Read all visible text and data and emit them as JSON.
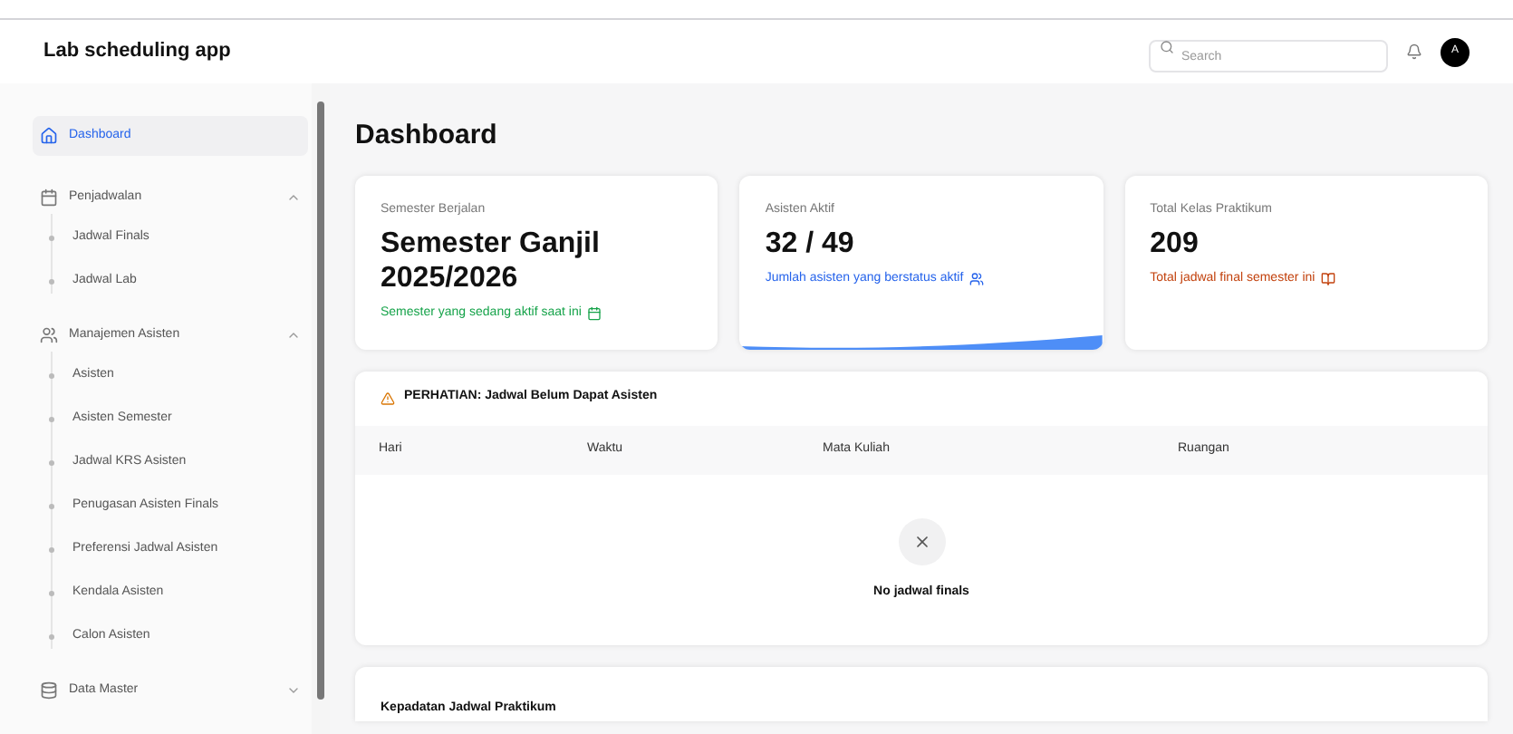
{
  "app": {
    "title": "Lab scheduling app",
    "search": {
      "placeholder": "Search"
    },
    "avatar": "A"
  },
  "sidebar": {
    "items": [
      {
        "kind": "link",
        "label": "Dashboard",
        "selected": true
      },
      {
        "kind": "group",
        "label": "Penjadwalan",
        "expanded": true,
        "children": [
          {
            "label": "Jadwal Finals",
            "selected": false
          },
          {
            "label": "Jadwal Lab",
            "selected": false
          }
        ]
      },
      {
        "kind": "group",
        "label": "Manajemen Asisten",
        "expanded": true,
        "children": [
          {
            "label": "Asisten",
            "selected": false
          },
          {
            "label": "Asisten Semester",
            "selected": false
          },
          {
            "label": "Jadwal KRS Asisten",
            "selected": false
          },
          {
            "label": "Penugasan Asisten Finals",
            "selected": false
          },
          {
            "label": "Preferensi Jadwal Asisten",
            "selected": false
          },
          {
            "label": "Kendala Asisten",
            "selected": false
          },
          {
            "label": "Calon Asisten",
            "selected": false
          }
        ]
      },
      {
        "kind": "group",
        "label": "Data Master",
        "expanded": false
      }
    ]
  },
  "page": {
    "title": "Dashboard",
    "stats": [
      {
        "label": "Semester Berjalan",
        "value": "Semester Ganjil 2025/2026",
        "note": "Semester yang sedang aktif saat ini",
        "color": "#16a34a"
      },
      {
        "label": "Asisten Aktif",
        "value": "32 / 49",
        "note": "Jumlah asisten yang berstatus aktif",
        "color": "#2563eb"
      },
      {
        "label": "Total Kelas Praktikum",
        "value": "209",
        "note": "Total jadwal final semester ini",
        "color": "#c2410c"
      }
    ],
    "alert": {
      "title": "PERHATIAN: Jadwal Belum Dapat Asisten",
      "columns": [
        "Hari",
        "Waktu",
        "Mata Kuliah",
        "Ruangan"
      ],
      "empty": "No jadwal finals"
    },
    "density": {
      "title": "Kepadatan Jadwal Praktikum"
    }
  }
}
